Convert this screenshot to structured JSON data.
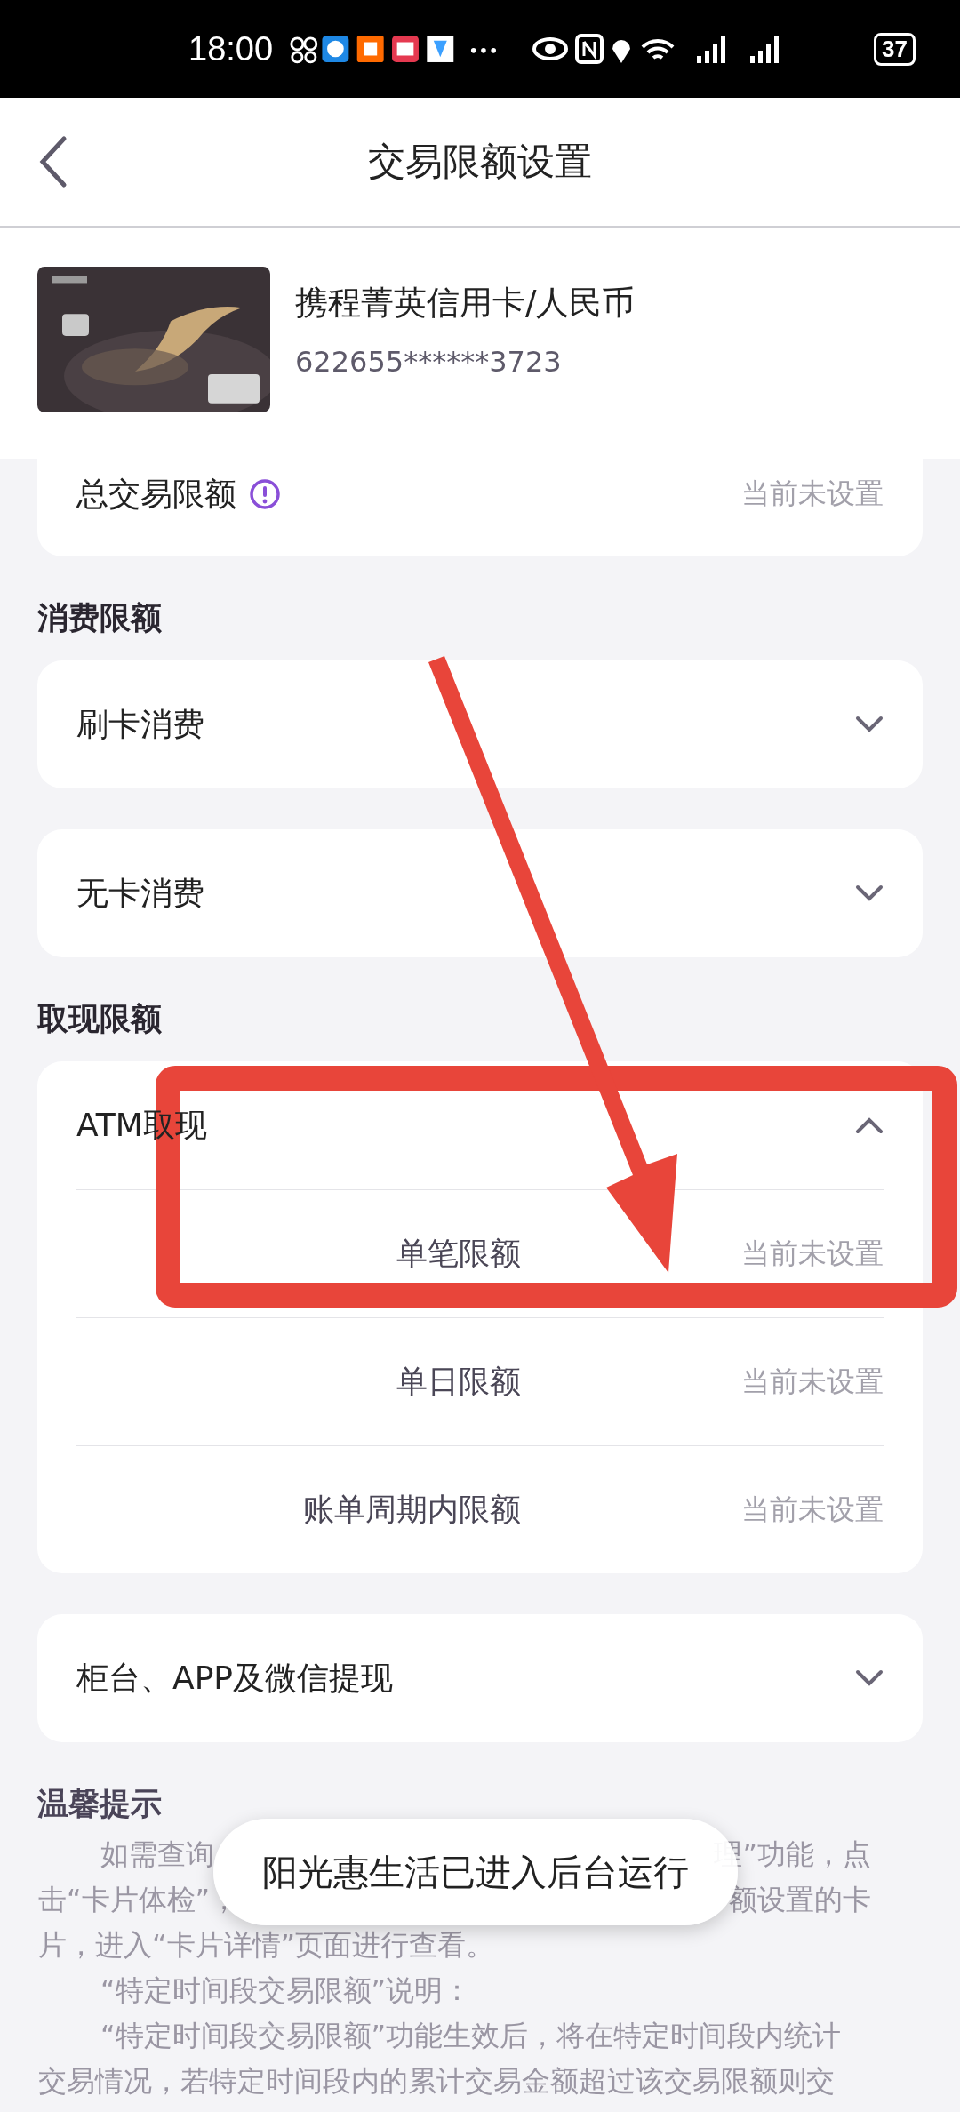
{
  "status_bar": {
    "time": "18:00",
    "battery": "37"
  },
  "header": {
    "title": "交易限额设置"
  },
  "card": {
    "name": "携程菁英信用卡/人民币",
    "number": "622655******3723"
  },
  "total_limit": {
    "label": "总交易限额",
    "value": "当前未设置"
  },
  "sections": [
    {
      "title": "消费限额",
      "groups": [
        {
          "label": "刷卡消费",
          "expanded": false
        },
        {
          "label": "无卡消费",
          "expanded": false
        }
      ]
    },
    {
      "title": "取现限额",
      "groups": [
        {
          "label": "ATM取现",
          "expanded": true,
          "rows": [
            {
              "label": "单笔限额",
              "value": "当前未设置"
            },
            {
              "label": "单日限额",
              "value": "当前未设置"
            },
            {
              "label": "账单周期内限额",
              "value": "当前未设置"
            }
          ]
        },
        {
          "label": "柜台、APP及微信提现",
          "expanded": false
        }
      ]
    }
  ],
  "tips": {
    "title": "温馨提示",
    "lines": [
      {
        "indented": true,
        "parts": [
          "如需查询",
          "理”功能，点"
        ]
      },
      {
        "indented": false,
        "parts": [
          "击“卡片体检”，",
          "额设置的卡"
        ]
      },
      {
        "indented": false,
        "parts": [
          "片，进入“卡片详情”页面进行查看。"
        ]
      },
      {
        "indented": true,
        "parts": [
          "“特定时间段交易限额”说明："
        ]
      },
      {
        "indented": true,
        "parts": [
          "“特定时间段交易限额”功能生效后，将在特定时间段内统计"
        ]
      },
      {
        "indented": false,
        "parts": [
          "交易情况，若特定时间段内的累计交易金额超过该交易限额则交"
        ]
      }
    ]
  },
  "toast": {
    "text": "阳光惠生活已进入后台运行"
  }
}
